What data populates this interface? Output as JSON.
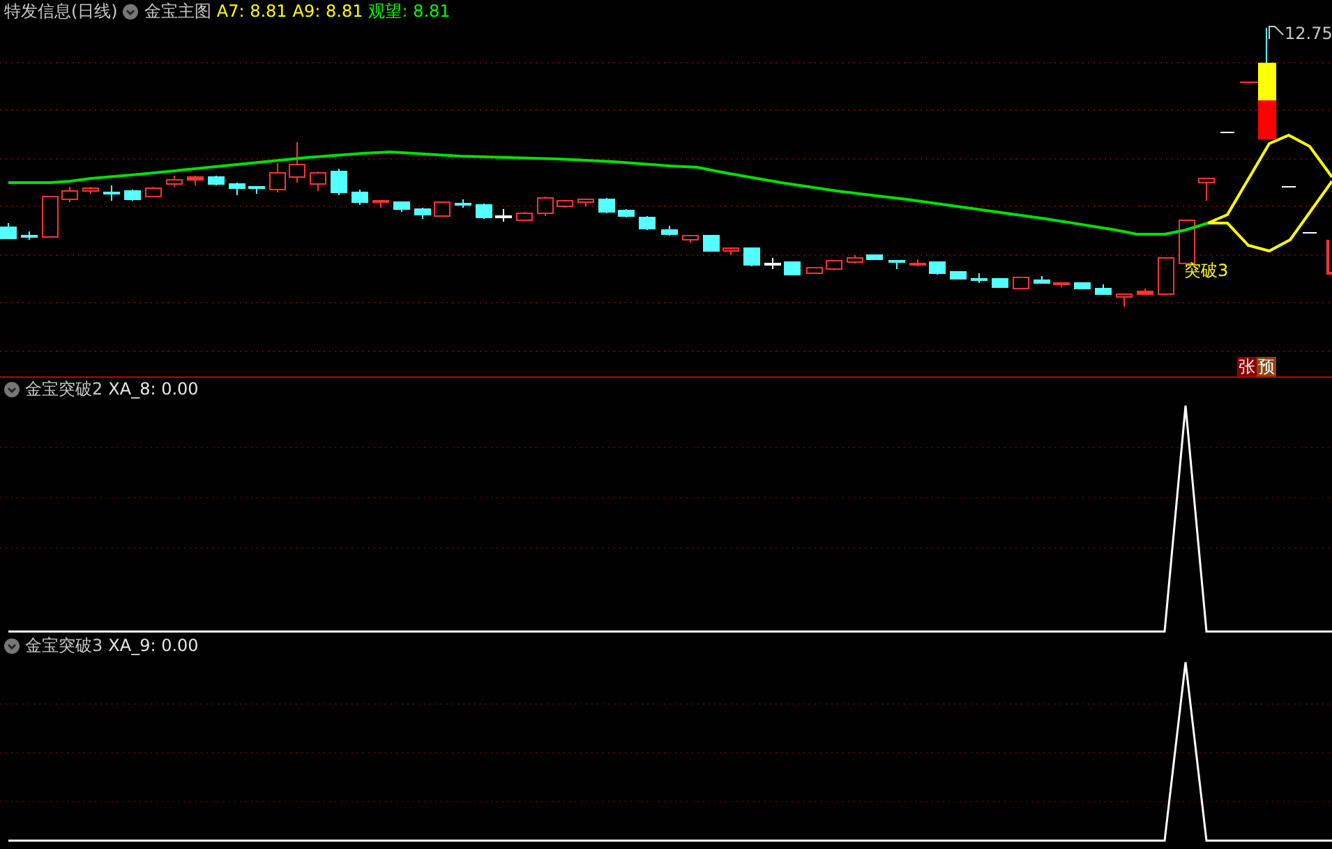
{
  "header": {
    "stock": "特发信息(日线)",
    "indicator": "金宝主图",
    "readings": [
      {
        "label": "A7: 8.81",
        "color": "#ffff00"
      },
      {
        "label": "A9: 8.81",
        "color": "#ffff00"
      },
      {
        "label": "观望: 8.81",
        "color": "#00ff00"
      }
    ]
  },
  "price_label": "12.75",
  "signal_label": "突破3",
  "badges": [
    {
      "text": "张",
      "color": "#8b0000"
    },
    {
      "text": "预",
      "color": "#8b4513"
    }
  ],
  "panes": [
    {
      "name": "金宝突破2",
      "reading": "XA_8: 0.00"
    },
    {
      "name": "金宝突破3",
      "reading": "XA_9: 0.00"
    }
  ]
}
